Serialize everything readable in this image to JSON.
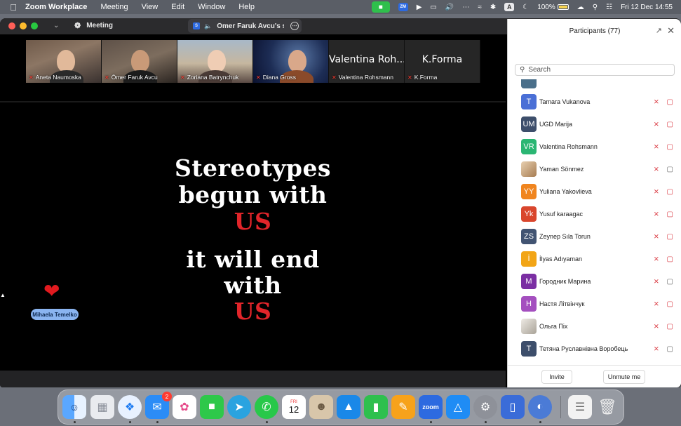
{
  "menubar": {
    "apple_icon": "apple-icon",
    "items": [
      "Zoom Workplace",
      "Meeting",
      "View",
      "Edit",
      "Window",
      "Help"
    ],
    "battery": "100%",
    "datetime": "Fri 12 Dec  14:55",
    "zm_label": "ZM",
    "a_label": "A"
  },
  "window": {
    "meeting_tab": "Meeting",
    "share_tab": "Ömer Faruk Avcu's screen",
    "share_icon_label": "S"
  },
  "gallery": [
    {
      "name": "Aneta Naumoska",
      "muted": true
    },
    {
      "name": "Ömer Faruk Avcu",
      "muted": true
    },
    {
      "name": "Zoriana Batrynchuk",
      "muted": true
    },
    {
      "name": "Diana Gross",
      "muted": true
    },
    {
      "name": "Valentina Rohsmann",
      "display": "Valentina Roh...",
      "muted": true
    },
    {
      "name": "K.Forma",
      "display": "K.Forma",
      "muted": true
    }
  ],
  "slide": {
    "line1": "Stereotypes",
    "line2": "begun with",
    "line3": "US",
    "line4": "it will end",
    "line5": "with",
    "line6": "US"
  },
  "reaction": {
    "emoji": "❤",
    "name": "Mihaela Temelko"
  },
  "panel": {
    "title": "Participants (77)",
    "search_placeholder": "Search",
    "participants": [
      {
        "initials": "T",
        "name": "Tamara Vukanova",
        "color": "#4a6fd6",
        "video": false
      },
      {
        "initials": "UM",
        "name": "UGD Marija",
        "color": "#3d4e6b",
        "video": false
      },
      {
        "initials": "VR",
        "name": "Valentina Rohsmann",
        "color": "#2bb673",
        "video": false
      },
      {
        "initials": "",
        "name": "Yaman Sönmez",
        "color": "#c9a27a",
        "video": true
      },
      {
        "initials": "YY",
        "name": "Yuliana Yakovlieva",
        "color": "#f0851f",
        "video": false
      },
      {
        "initials": "Yk",
        "name": "Yusuf karaagac",
        "color": "#d9462d",
        "video": false
      },
      {
        "initials": "ZS",
        "name": "Zeynep Sıla Torun",
        "color": "#425472",
        "video": false
      },
      {
        "initials": "İ",
        "name": "İlyas Adıyaman",
        "color": "#f2a516",
        "video": false
      },
      {
        "initials": "М",
        "name": "Городник Марина",
        "color": "#7b2fa3",
        "video": true
      },
      {
        "initials": "Н",
        "name": "Настя Літвінчук",
        "color": "#a44fbf",
        "video": false
      },
      {
        "initials": "",
        "name": "Ольга Піх",
        "color": "#c8c4bd",
        "video": false
      },
      {
        "initials": "Т",
        "name": "Тетяна Руславнівна Воробець",
        "color": "#3d4e6b",
        "video": true
      }
    ],
    "invite": "Invite",
    "unmute": "Unmute me"
  },
  "dock": {
    "mail_badge": "2",
    "calendar_day": "FRI",
    "calendar_date": "12",
    "zoom_label": "zoom"
  },
  "colors": {
    "slide_accent": "#e1252a",
    "muted_red": "#d9363e",
    "zoom_blue": "#2d6ae0"
  }
}
